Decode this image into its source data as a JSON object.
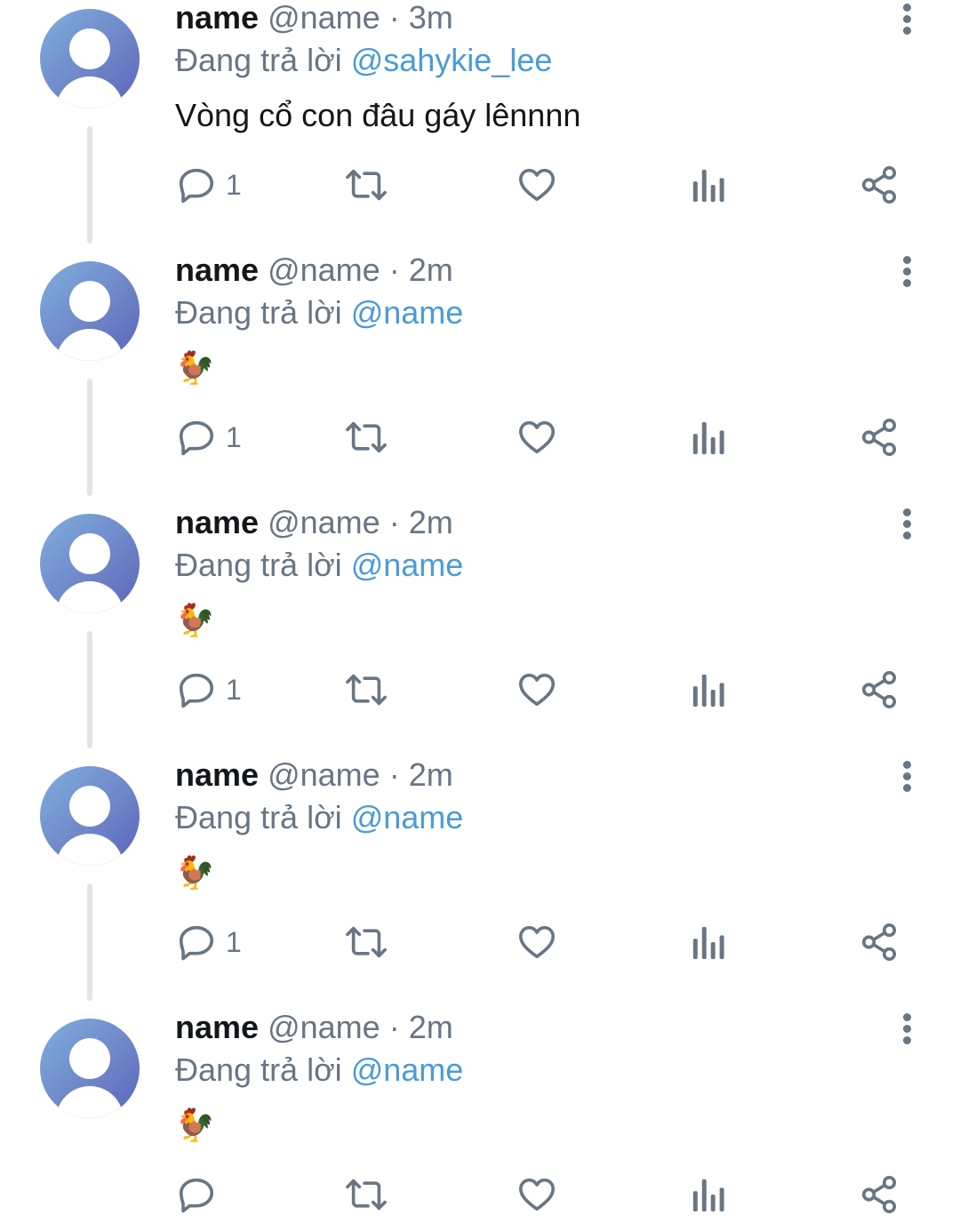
{
  "colors": {
    "text_primary": "#14171a",
    "text_secondary": "#687684",
    "mention": "#4a9bd6",
    "thread_line": "#e1e5e9",
    "icon": "#687684"
  },
  "tweets": [
    {
      "name": "name",
      "handle": "@name",
      "separator": "·",
      "time": "3m",
      "replying_label": "Đang trả lời",
      "replying_to": "@sahykie_lee",
      "content": "Vòng cổ con đâu gáy lênnnn",
      "reply_count": "1"
    },
    {
      "name": "name",
      "handle": "@name",
      "separator": "·",
      "time": "2m",
      "replying_label": "Đang trả lời",
      "replying_to": "@name",
      "content": "🐓",
      "reply_count": "1"
    },
    {
      "name": "name",
      "handle": "@name",
      "separator": "·",
      "time": "2m",
      "replying_label": "Đang trả lời",
      "replying_to": "@name",
      "content": "🐓",
      "reply_count": "1"
    },
    {
      "name": "name",
      "handle": "@name",
      "separator": "·",
      "time": "2m",
      "replying_label": "Đang trả lời",
      "replying_to": "@name",
      "content": "🐓",
      "reply_count": "1"
    },
    {
      "name": "name",
      "handle": "@name",
      "separator": "·",
      "time": "2m",
      "replying_label": "Đang trả lời",
      "replying_to": "@name",
      "content": "🐓",
      "reply_count": ""
    }
  ],
  "icons": {
    "reply": "reply-icon",
    "retweet": "retweet-icon",
    "like": "heart-icon",
    "analytics": "analytics-icon",
    "share": "share-icon",
    "more": "more-vertical-icon"
  }
}
